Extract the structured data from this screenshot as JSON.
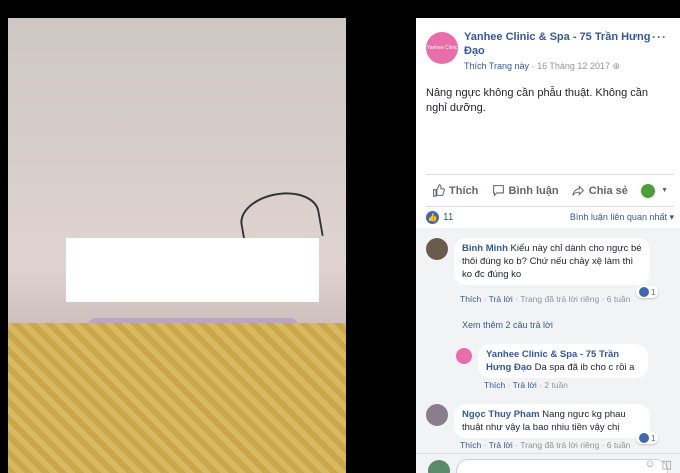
{
  "post": {
    "page_name": "Yanhee Clinic & Spa - 75 Trần Hưng Đạo",
    "avatar_text": "Yanhee Clinic & Spa",
    "like_page": "Thích Trang này",
    "date": "16 Tháng 12 2017",
    "caption": "Nâng ngực không cần phẫu thuật. Không cần nghỉ dưỡng."
  },
  "actions": {
    "like": "Thích",
    "comment": "Bình luận",
    "share": "Chia sẻ"
  },
  "stats": {
    "like_count": "11",
    "sort": "Bình luận liên quan nhất ▾"
  },
  "comments": [
    {
      "name": "Bình Minh",
      "text": "Kiểu này chỉ dành cho ngực bé thôi đúng ko b? Chứ nếu chảy xệ làm thì ko đc đúng ko",
      "like": "Thích",
      "reply": "Trả lời",
      "status": "Trang đã trả lời riêng",
      "time": "6 tuần",
      "reactions": "1"
    },
    {
      "name": "Yanhee Clinic & Spa - 75 Trần Hưng Đạo",
      "text": "Da spa đã ib cho c rồi a",
      "like": "Thích",
      "reply": "Trả lời",
      "time": "2 tuần"
    },
    {
      "name": "Ngọc Thuy Pham",
      "text": "Nang ngưc kg phau thuật như vậy la bao nhiu tiền vậy chị",
      "like": "Thích",
      "reply": "Trả lời",
      "status": "Trang đã trả lời riêng",
      "time": "6 tuần",
      "reactions": "1"
    }
  ],
  "more_replies": "Xem thêm 2 câu trả lời"
}
